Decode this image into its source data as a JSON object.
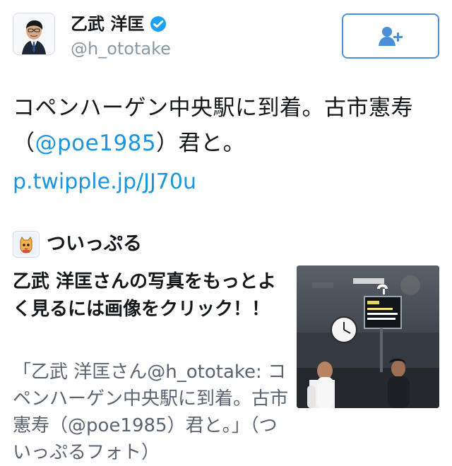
{
  "header": {
    "display_name": "乙武 洋匡",
    "handle": "@h_ototake",
    "verified_icon": "verified-badge-icon",
    "follow_icon": "add-user-icon"
  },
  "tweet": {
    "text_part_1": "コペンハーゲン中央駅に到着。古市憲寿（",
    "mention": "@poe1985",
    "text_part_2": "）君と。",
    "link": "p.twipple.jp/JJ70u"
  },
  "card": {
    "source_name": "ついっぷる",
    "title": "乙武 洋匡さんの写真をもっとよく見るには画像をクリック！！",
    "description": "「乙武 洋匡さん@h_ototake: コペンハーゲン中央駅に到着。古市憲寿（@poe1985）君と。」（ついっぷるフォト）",
    "image_icon": "photo-thumbnail-icon"
  },
  "colors": {
    "link": "#1b95e0",
    "button_border": "#4a90d9",
    "secondary_text": "#8899a6",
    "primary_text": "#14171a",
    "description_text": "#5a6470"
  }
}
